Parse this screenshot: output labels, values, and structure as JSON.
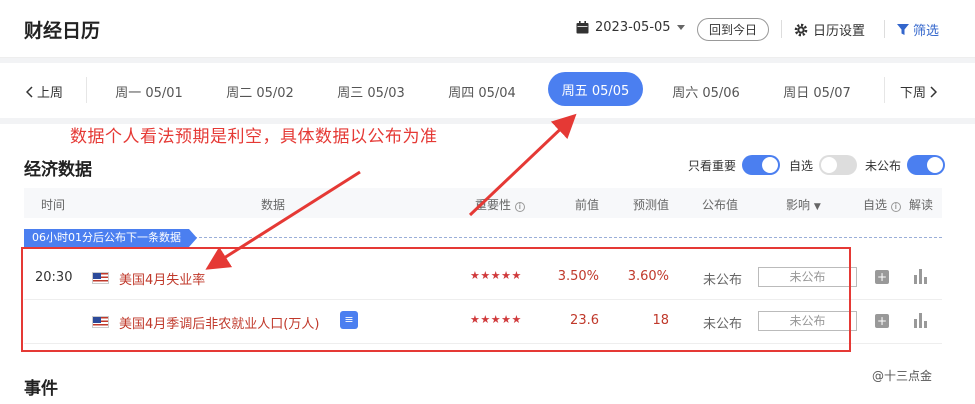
{
  "header": {
    "title": "财经日历",
    "date": "2023-05-05",
    "today_label": "回到今日",
    "settings_label": "日历设置",
    "filter_label": "筛选"
  },
  "week_nav": {
    "prev": "上周",
    "next": "下周",
    "days": [
      {
        "label": "周一 05/01"
      },
      {
        "label": "周二 05/02"
      },
      {
        "label": "周三 05/03"
      },
      {
        "label": "周四 05/04"
      },
      {
        "label": "周五 05/05",
        "active": true
      },
      {
        "label": "周六 05/06"
      },
      {
        "label": "周日 05/07"
      }
    ]
  },
  "annotation": "数据个人看法预期是利空，具体数据以公布为准",
  "economic": {
    "title": "经济数据",
    "toggles": {
      "important": "只看重要",
      "watch": "自选",
      "unpublished": "未公布"
    },
    "columns": {
      "time": "时间",
      "data": "数据",
      "importance": "重要性",
      "previous": "前值",
      "forecast": "预测值",
      "actual": "公布值",
      "impact": "影响",
      "watch": "自选",
      "explain": "解读"
    },
    "countdown": "06小时01分后公布下一条数据",
    "rows": [
      {
        "time": "20:30",
        "name": "美国4月失业率",
        "stars": "★★★★★",
        "previous": "3.50%",
        "forecast": "3.60%",
        "actual": "未公布",
        "impact": "未公布"
      },
      {
        "time": "",
        "name": "美国4月季调后非农就业人口(万人)",
        "stars": "★★★★★",
        "previous": "23.6",
        "forecast": "18",
        "actual": "未公布",
        "impact": "未公布"
      }
    ]
  },
  "events": {
    "title": "事件"
  },
  "watermark": "@十三点金",
  "colors": {
    "accent": "#4b7ff0",
    "alert": "#e53935",
    "value_red": "#c0392b"
  }
}
